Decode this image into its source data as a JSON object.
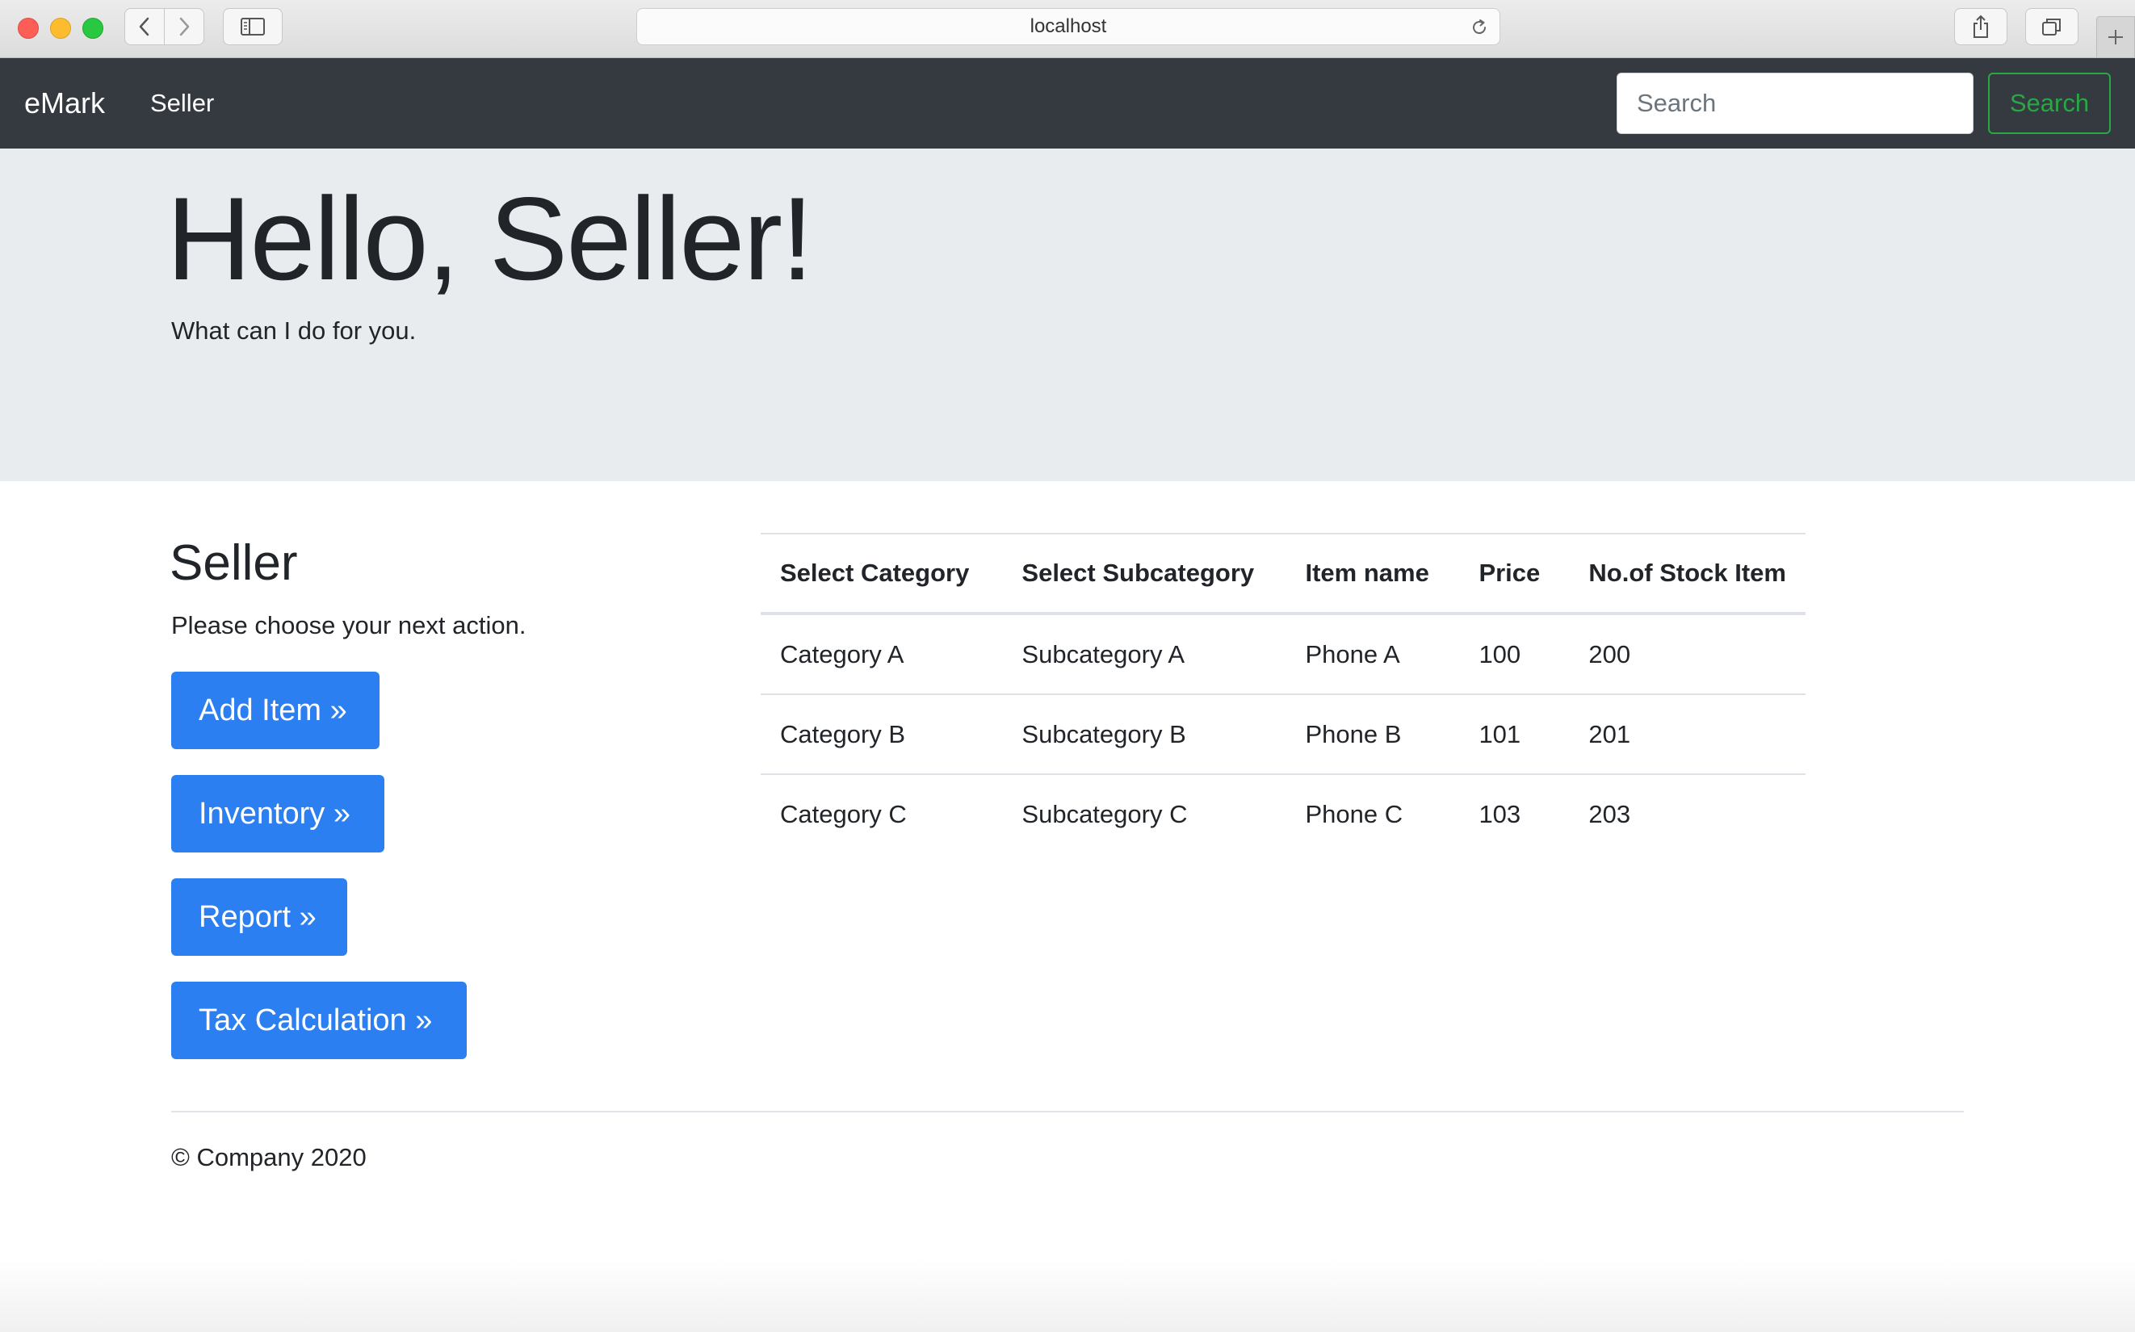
{
  "browser": {
    "url": "localhost"
  },
  "navbar": {
    "brand": "eMark",
    "link": "Seller",
    "search_placeholder": "Search",
    "search_button": "Search"
  },
  "jumbotron": {
    "title": "Hello, Seller!",
    "lead": "What can I do for you."
  },
  "main": {
    "heading": "Seller",
    "subheading": "Please choose your next action.",
    "buttons": [
      {
        "label": "Add Item »"
      },
      {
        "label": "Inventory »"
      },
      {
        "label": "Report »"
      },
      {
        "label": "Tax Calculation »"
      }
    ]
  },
  "table": {
    "headers": [
      "Select Category",
      "Select Subcategory",
      "Item name",
      "Price",
      "No.of Stock Item"
    ],
    "rows": [
      [
        "Category A",
        "Subcategory A",
        "Phone A",
        "100",
        "200"
      ],
      [
        "Category B",
        "Subcategory B",
        "Phone B",
        "101",
        "201"
      ],
      [
        "Category C",
        "Subcategory C",
        "Phone C",
        "103",
        "203"
      ]
    ]
  },
  "footer": {
    "text": "© Company 2020"
  },
  "colors": {
    "navbar_bg": "#343a40",
    "jumbotron_bg": "#e9ecef",
    "primary_button": "#2c7ff0",
    "search_button": "#28a745"
  }
}
